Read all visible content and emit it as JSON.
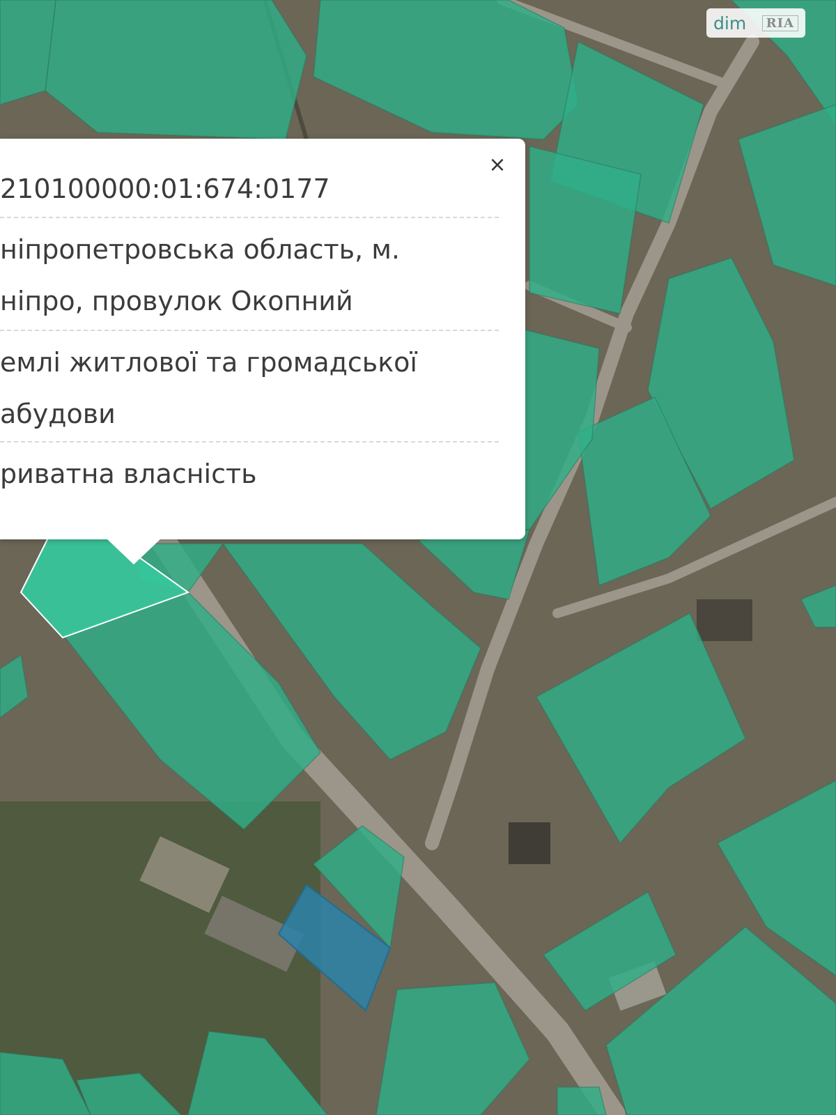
{
  "watermark": {
    "brand": "dim",
    "mark": "RIA"
  },
  "popup": {
    "cadastral_number": "210100000:01:674:0177",
    "address_line1": "ніпропетровська область, м.",
    "address_line2": "ніпро, провулок Окопний",
    "purpose_line1": "емлі житлової та громадської",
    "purpose_line2": "абудови",
    "ownership": "риватна власність",
    "close_label": "×"
  },
  "map": {
    "parcel_color": "#2fae88",
    "selected_parcel_color": "#2c82a8",
    "highlighted_parcel_color": "#36c89c"
  }
}
